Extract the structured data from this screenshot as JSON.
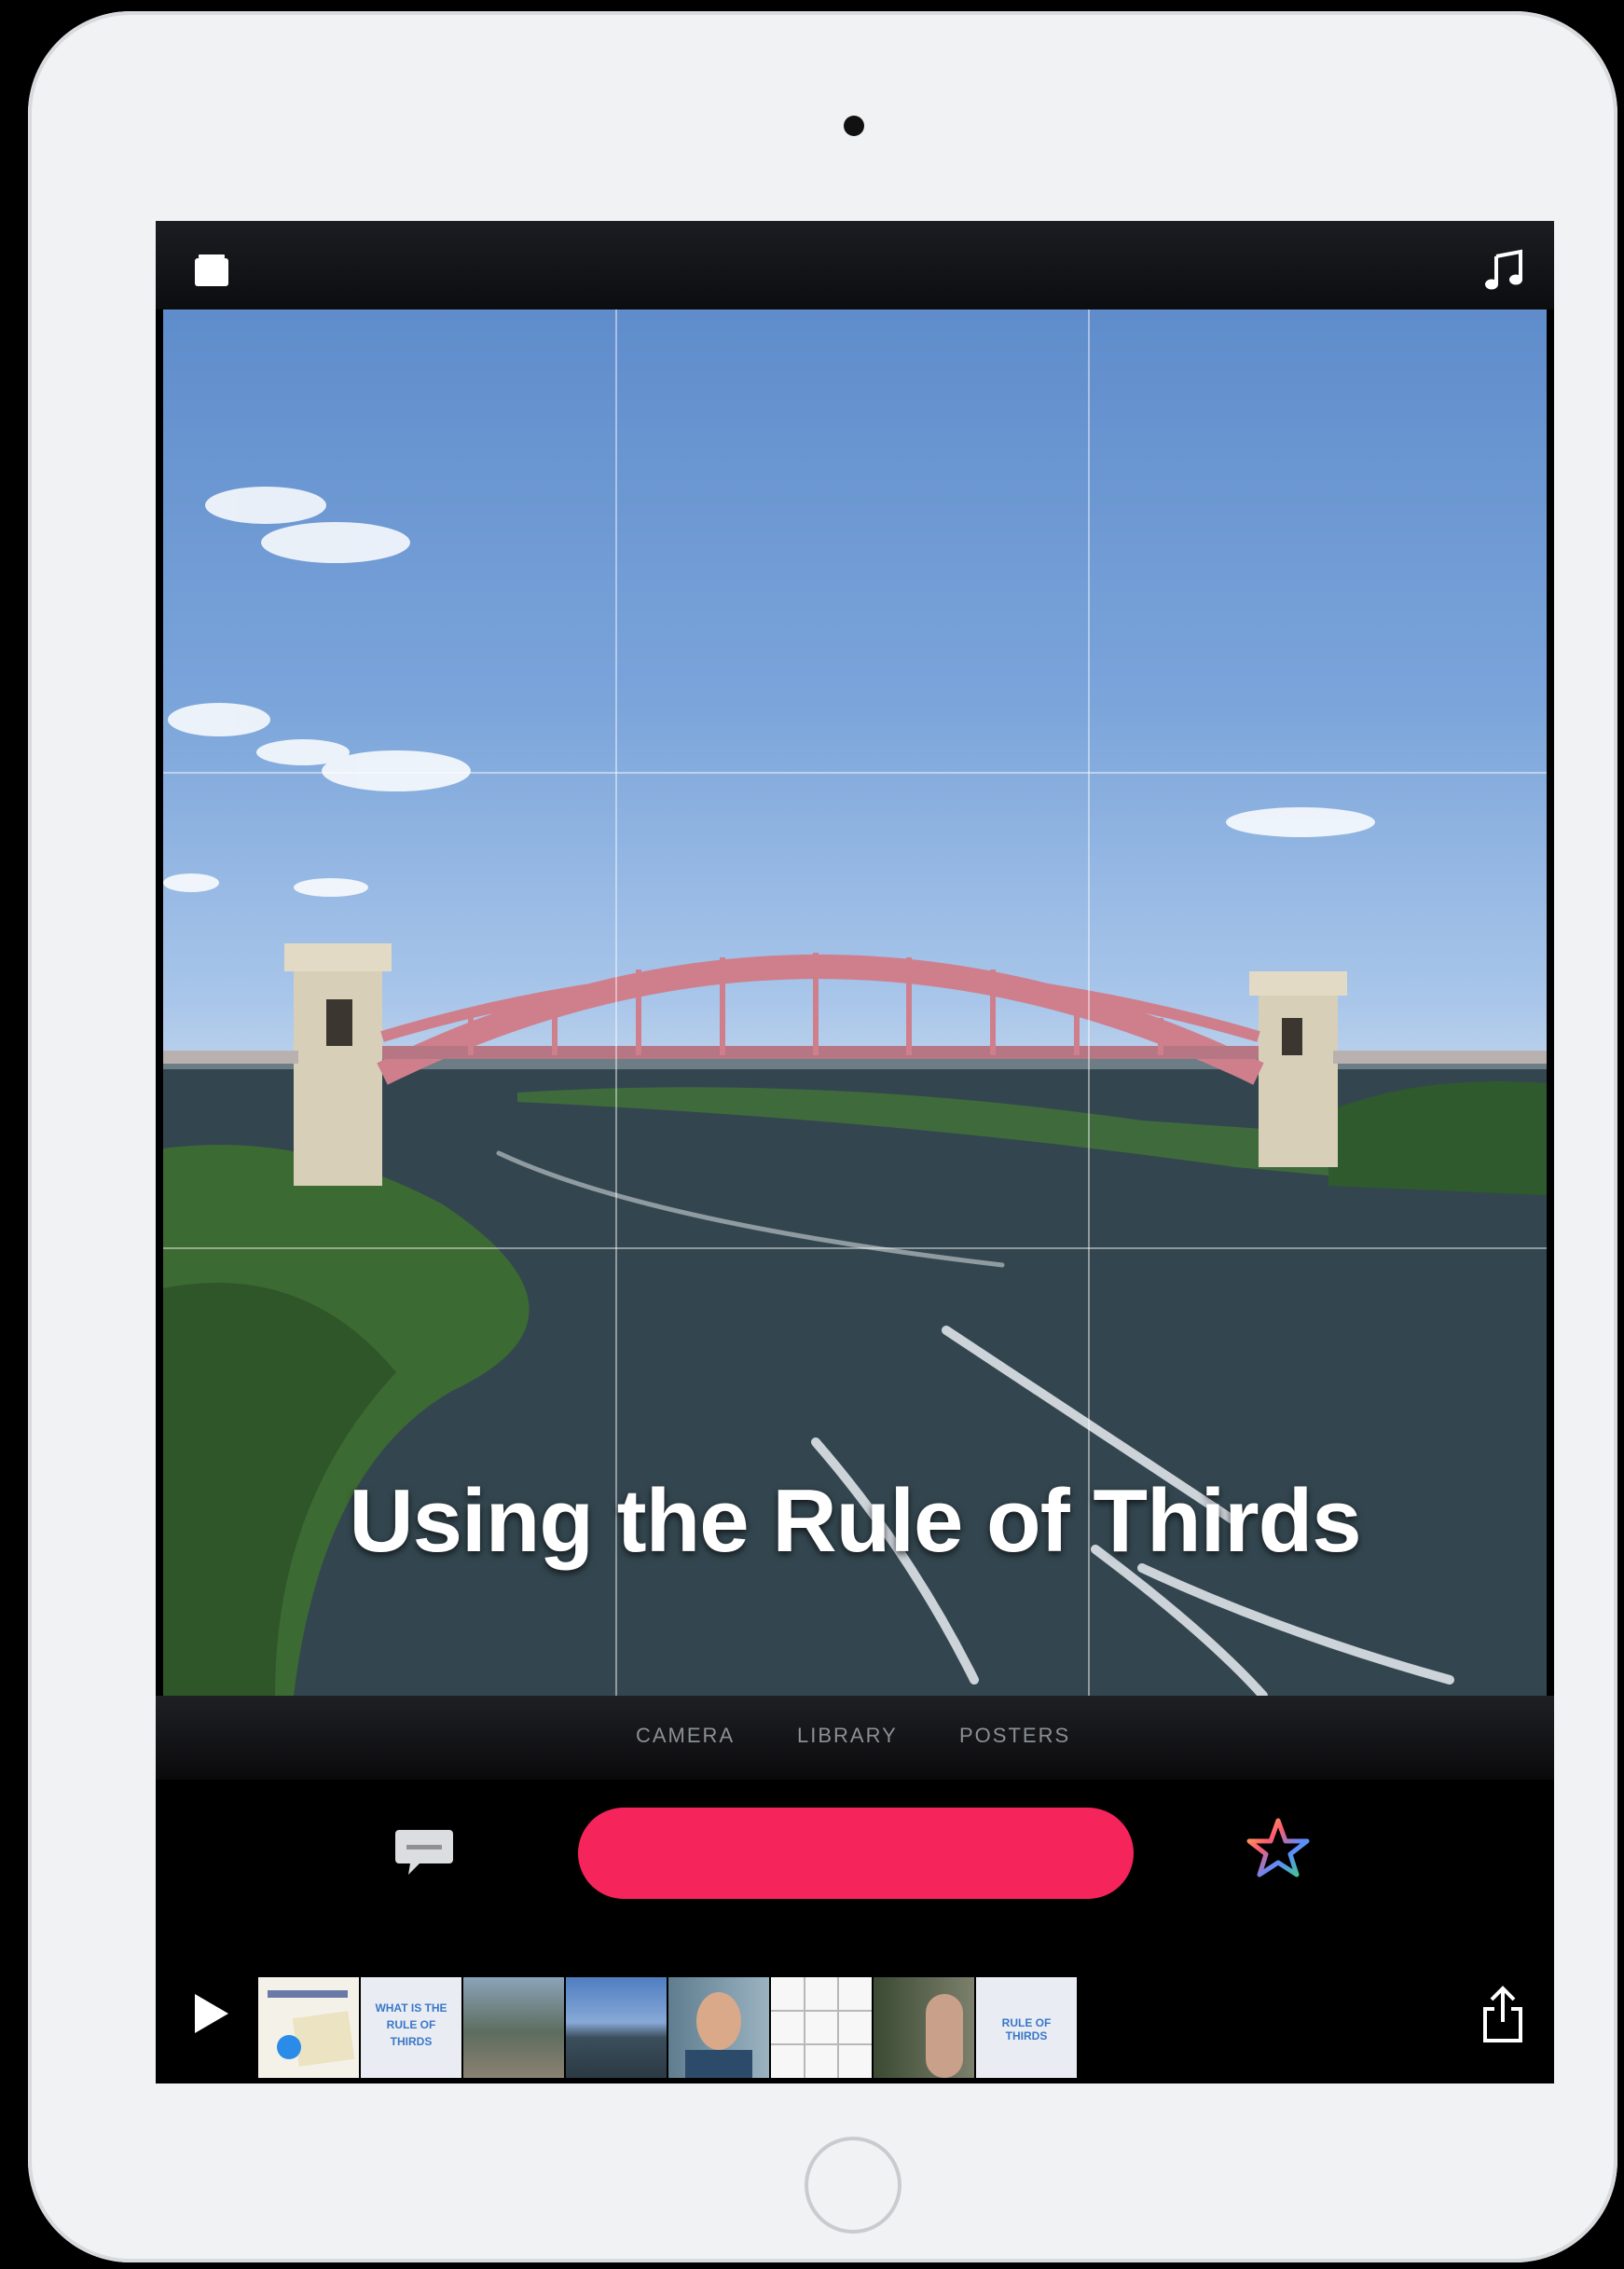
{
  "topbar": {
    "left_icon": "projects-icon",
    "right_icon": "music-note-icon"
  },
  "viewfinder": {
    "caption": "Using the Rule of Thirds",
    "grid": "rule-of-thirds 3x3"
  },
  "mode_tabs": [
    {
      "label": "CAMERA"
    },
    {
      "label": "LIBRARY"
    },
    {
      "label": "POSTERS"
    }
  ],
  "controls": {
    "left_icon": "speech-bubble-icon",
    "record_color": "#f5245a",
    "right_icon": "star-icon"
  },
  "timeline": {
    "play_icon": "play-icon",
    "share_icon": "share-icon",
    "clips": [
      {
        "kind": "title-card"
      },
      {
        "kind": "text-card",
        "text": "WHAT IS THE RULE OF THIRDS"
      },
      {
        "kind": "photo"
      },
      {
        "kind": "photo"
      },
      {
        "kind": "photo"
      },
      {
        "kind": "grid"
      },
      {
        "kind": "photo"
      },
      {
        "kind": "text-card",
        "text": "RULE OF THIRDS"
      }
    ]
  }
}
